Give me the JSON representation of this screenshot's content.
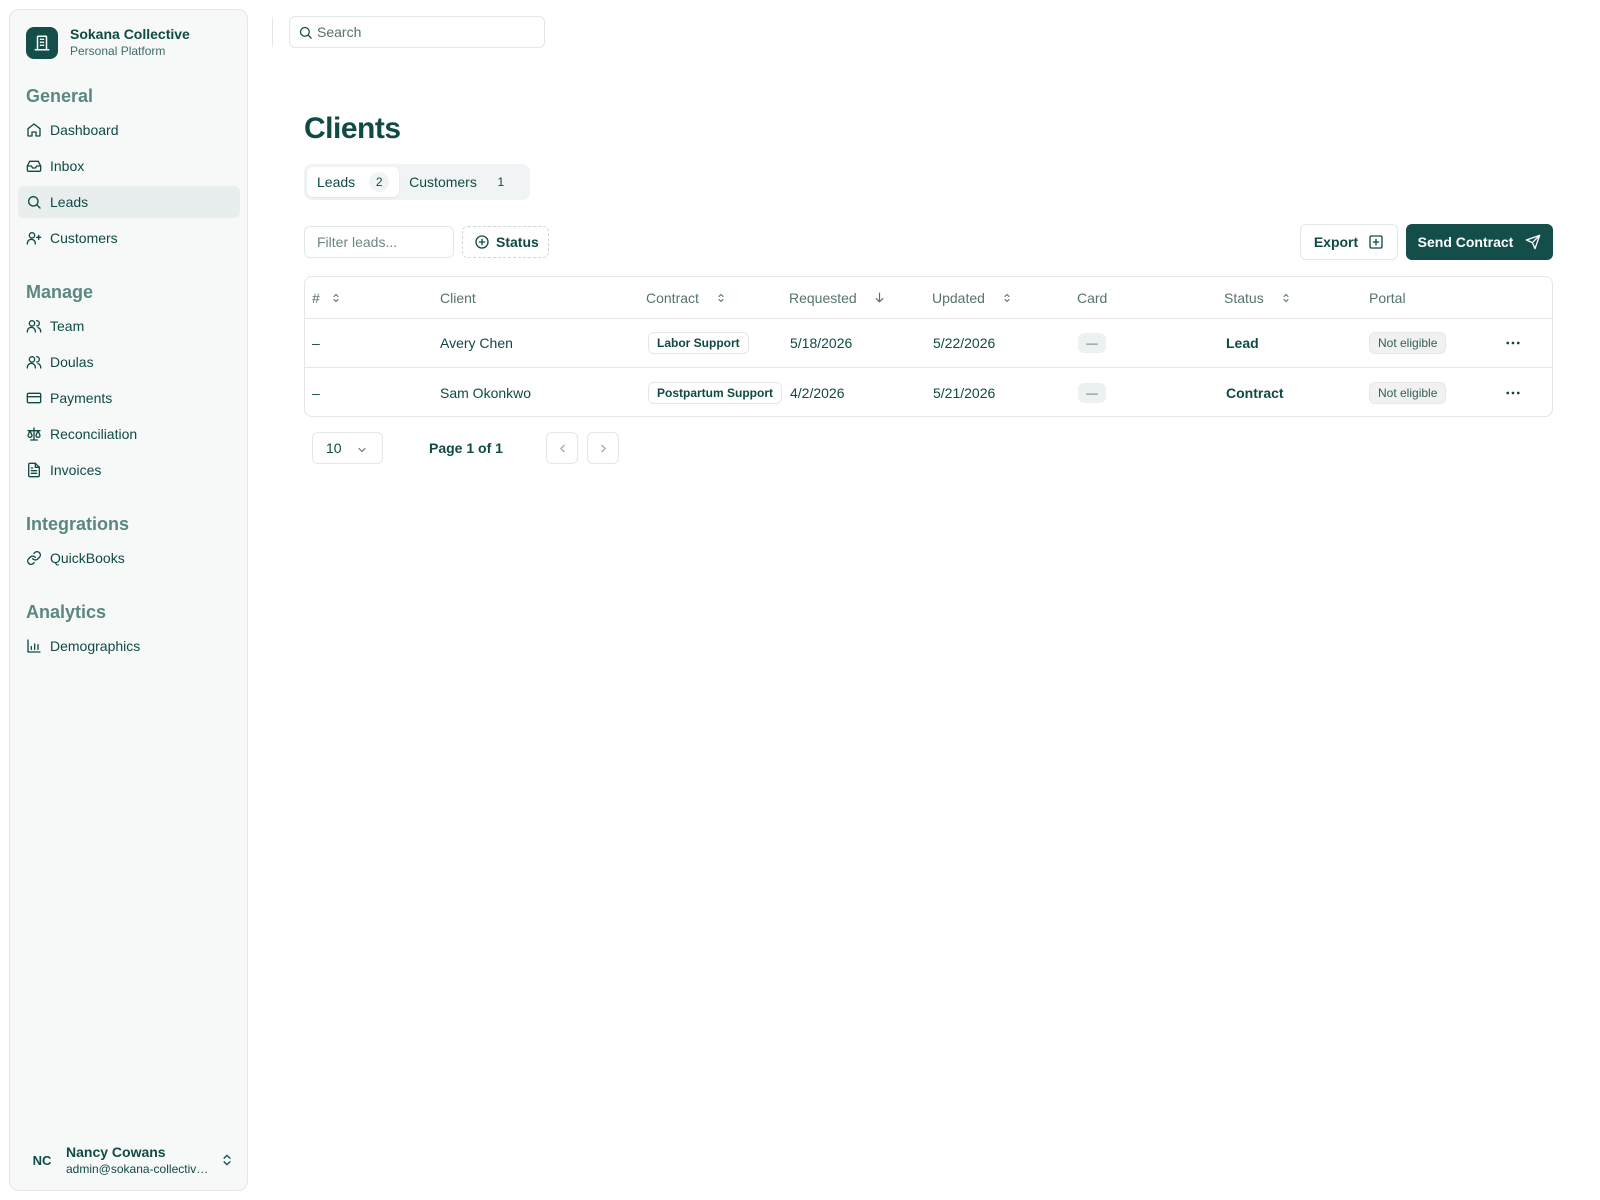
{
  "brand": {
    "name": "Sokana Collective",
    "subtitle": "Personal Platform",
    "icon": "building-icon"
  },
  "sidebar": {
    "sections": [
      {
        "title": "General",
        "items": [
          {
            "label": "Dashboard",
            "icon": "home-icon",
            "active": false
          },
          {
            "label": "Inbox",
            "icon": "inbox-icon",
            "active": false
          },
          {
            "label": "Leads",
            "icon": "search-icon",
            "active": true
          },
          {
            "label": "Customers",
            "icon": "user-plus-icon",
            "active": false
          }
        ]
      },
      {
        "title": "Manage",
        "items": [
          {
            "label": "Team",
            "icon": "users-icon"
          },
          {
            "label": "Doulas",
            "icon": "users-icon"
          },
          {
            "label": "Payments",
            "icon": "credit-card-icon"
          },
          {
            "label": "Reconciliation",
            "icon": "scale-icon"
          },
          {
            "label": "Invoices",
            "icon": "file-text-icon"
          }
        ]
      },
      {
        "title": "Integrations",
        "items": [
          {
            "label": "QuickBooks",
            "icon": "link-icon"
          }
        ]
      },
      {
        "title": "Analytics",
        "items": [
          {
            "label": "Demographics",
            "icon": "bar-chart-icon"
          }
        ]
      }
    ]
  },
  "user": {
    "initials": "NC",
    "name": "Nancy Cowans",
    "email": "admin@sokana-collective.com"
  },
  "search": {
    "placeholder": "Search"
  },
  "page": {
    "title": "Clients"
  },
  "tabs": [
    {
      "label": "Leads",
      "count": "2",
      "active": true
    },
    {
      "label": "Customers",
      "count": "1",
      "active": false
    }
  ],
  "toolbar": {
    "filter_placeholder": "Filter leads...",
    "status_label": "Status",
    "export_label": "Export",
    "send_label": "Send Contract"
  },
  "table": {
    "columns": [
      "#",
      "Client",
      "Contract",
      "Requested",
      "Updated",
      "Card",
      "Status",
      "Portal"
    ],
    "rows": [
      {
        "num": "–",
        "client": "Avery Chen",
        "contract": "Labor Support",
        "requested": "5/18/2026",
        "updated": "5/22/2026",
        "card": "—",
        "status": "Lead",
        "portal": "Not eligible"
      },
      {
        "num": "–",
        "client": "Sam Okonkwo",
        "contract": "Postpartum Support",
        "requested": "4/2/2026",
        "updated": "5/21/2026",
        "card": "—",
        "status": "Contract",
        "portal": "Not eligible"
      }
    ]
  },
  "pagination": {
    "page_size": "10",
    "page_info": "Page 1 of 1"
  },
  "colors": {
    "primary": "#134e4a",
    "text": "#0f4a45",
    "section": "#5a8782"
  }
}
